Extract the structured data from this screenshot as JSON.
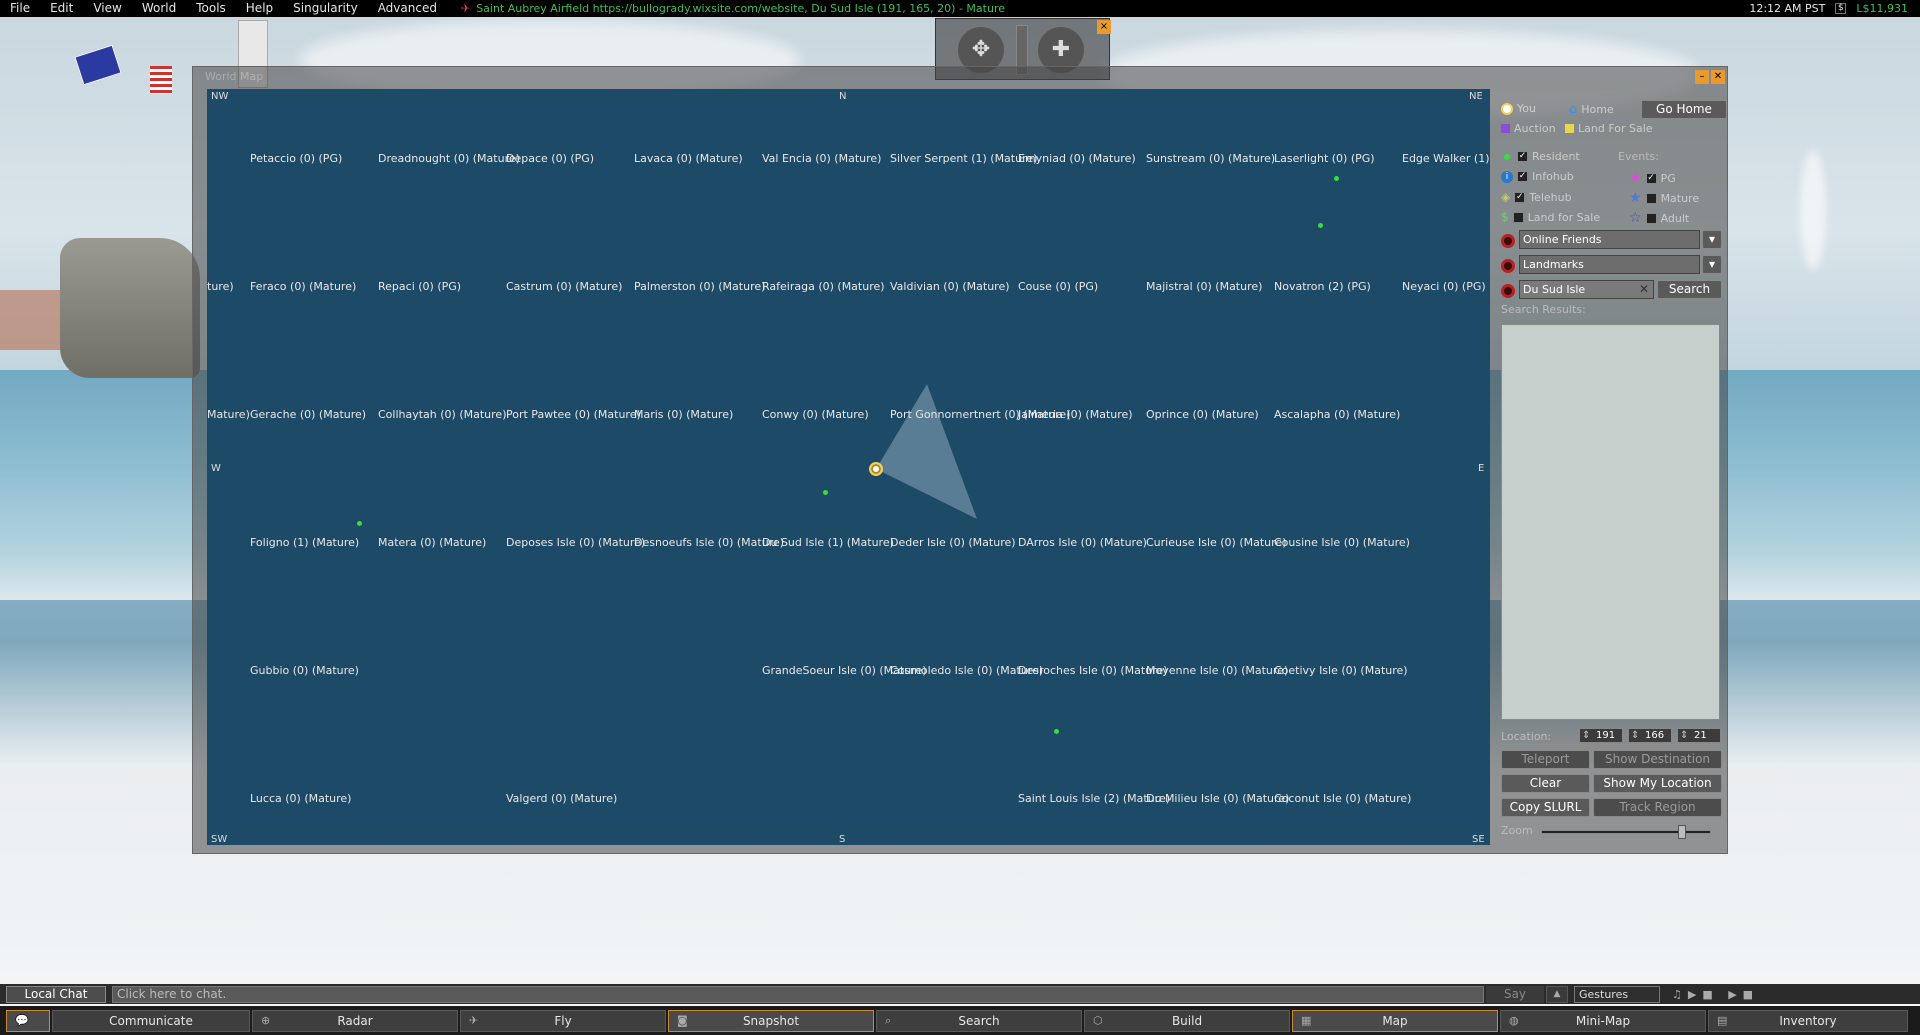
{
  "menubar": {
    "items": [
      "File",
      "Edit",
      "View",
      "World",
      "Tools",
      "Help",
      "Singularity",
      "Advanced"
    ],
    "location": "Saint Aubrey Airfield https://bullogrady.wixsite.com/website, Du Sud Isle (191, 165, 20) - Mature",
    "time": "12:12 AM PST",
    "currency_icon": "$",
    "balance": "L$11,931"
  },
  "camera_controls": {
    "close_label": "×"
  },
  "world_map": {
    "title": "World Map",
    "compass": {
      "nw": "NW",
      "n": "N",
      "ne": "NE",
      "w": "W",
      "e": "E",
      "sw": "SW",
      "s": "S",
      "se": "SE"
    },
    "regions": [
      "Petaccio (0) (PG)",
      "Dreadnought (0) (Mature)",
      "Depace (0) (PG)",
      "Lavaca (0) (Mature)",
      "Val Encia (0) (Mature)",
      "Silver Serpent (1) (Mature)",
      "Emyniad (0) (Mature)",
      "Sunstream (0) (Mature)",
      "Laserlight (0) (PG)",
      "Edge Walker (1) (PG)",
      "ture)",
      "Feraco (0) (Mature)",
      "Repaci (0) (PG)",
      "Castrum (0) (Mature)",
      "Palmerston (0) (Mature)",
      "Rafeiraga (0) (Mature)",
      "Valdivian (0) (Mature)",
      "Couse (0) (PG)",
      "Majistral (0) (Mature)",
      "Novatron (2) (PG)",
      "Neyaci (0) (PG)",
      "Mature)",
      "Gerache (0) (Mature)",
      "Collhaytah (0) (Mature)",
      "Port Pawtee (0) (Mature)",
      "Maris (0) (Mature)",
      "Conwy (0) (Mature)",
      "Port Gonnornertnert (0) (Mature)",
      "Jalmeria (0) (Mature)",
      "Oprince (0) (Mature)",
      "Ascalapha (0) (Mature)",
      "Foligno (1) (Mature)",
      "Matera (0) (Mature)",
      "Deposes Isle (0) (Mature)",
      "Desnoeufs Isle (0) (Mature)",
      "Du Sud Isle (1) (Mature)",
      "Deder Isle (0) (Mature)",
      "DArros Isle (0) (Mature)",
      "Curieuse Isle (0) (Mature)",
      "Cousine Isle (0) (Mature)",
      "Gubbio (0) (Mature)",
      "GrandeSoeur Isle (0) (Mature)",
      "Cosmoledo Isle (0) (Mature)",
      "Desroches Isle (0) (Mature)",
      "Moyenne Isle (0) (Mature)",
      "Coetivy Isle (0) (Mature)",
      "Lucca (0) (Mature)",
      "Valgerd (0) (Mature)",
      "Saint Louis Isle (2) (Mature)",
      "Du Milieu Isle (0) (Mature)",
      "Coconut Isle (0) (Mature)"
    ]
  },
  "panel": {
    "legend": {
      "you": "You",
      "home": "Home",
      "auction": "Auction",
      "for_sale": "Land For Sale"
    },
    "go_home": "Go Home",
    "filters": {
      "resident": "Resident",
      "infohub": "Infohub",
      "telehub": "Telehub",
      "land_for_sale": "Land for Sale"
    },
    "events_label": "Events:",
    "events": {
      "pg": "PG",
      "mature": "Mature",
      "adult": "Adult"
    },
    "check": "✓",
    "online_friends": "Online Friends",
    "landmarks": "Landmarks",
    "search_value": "Du Sud Isle",
    "clear_x": "✕",
    "search_button": "Search",
    "search_results_label": "Search Results:",
    "location_label": "Location:",
    "loc_x": "191",
    "loc_y": "166",
    "loc_z": "21",
    "teleport": "Teleport",
    "show_destination": "Show Destination",
    "clear": "Clear",
    "show_my_location": "Show My Location",
    "copy_slurl": "Copy SLURL",
    "track_region": "Track Region",
    "zoom_label": "Zoom",
    "zoom_level": 0.85
  },
  "chatbar": {
    "local_chat": "Local Chat",
    "placeholder": "Click here to chat.",
    "say": "Say",
    "gestures": "Gestures"
  },
  "toolbar": {
    "buttons": [
      "Communicate",
      "Radar",
      "Fly",
      "Snapshot",
      "Search",
      "Build",
      "Map",
      "Mini-Map",
      "Inventory"
    ]
  }
}
